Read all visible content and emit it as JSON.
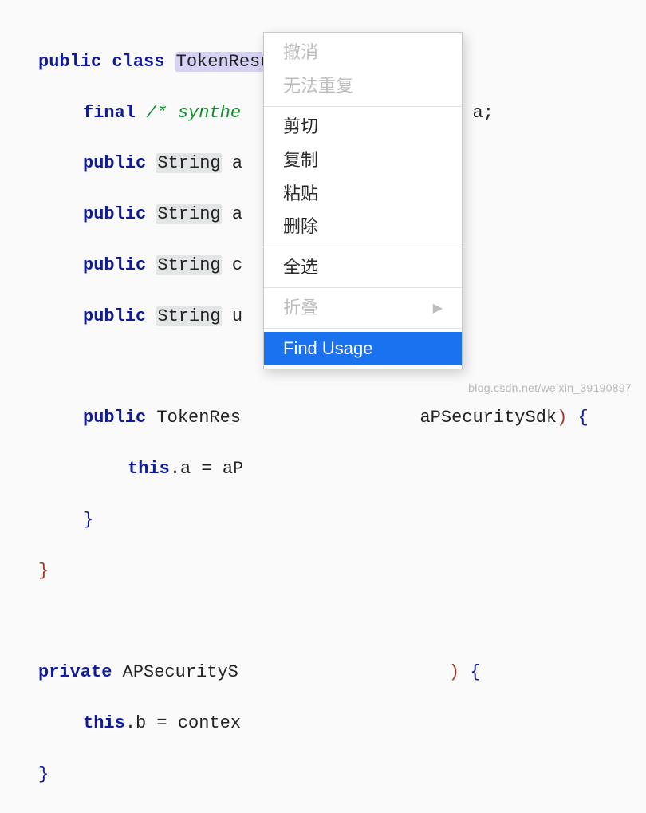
{
  "code": {
    "l1_kw_public": "public",
    "l1_kw_class": "class",
    "l1_classname": "TokenResult",
    "l1_brace": "{",
    "l2_kw_final": "final",
    "l2_comment": "/* synthe",
    "l2_tail": "Sdk a;",
    "l3_kw": "public",
    "l3_type": "String",
    "l3_tail": "a",
    "l4_kw": "public",
    "l4_type": "String",
    "l4_tail": "a",
    "l5_kw": "public",
    "l5_type": "String",
    "l5_tail": "c",
    "l6_kw": "public",
    "l6_type": "String",
    "l6_tail": "u",
    "l8_kw": "public",
    "l8_name": "TokenRes",
    "l8_tail_pre": "aPSecuritySdk",
    "l8_tail_paren": ")",
    "l8_brace": "{",
    "l9_kw_this": "this",
    "l9_rest": ".a = aP",
    "l10_brace": "}",
    "l11_brace": "}",
    "l13_kw_private": "private",
    "l13_name": "APSecurityS",
    "l13_paren": ")",
    "l13_brace": "{",
    "l14_kw_this": "this",
    "l14_rest": ".b = contex",
    "l15_brace": "}"
  },
  "menu": {
    "undo": "撤消",
    "redo": "无法重复",
    "cut": "剪切",
    "copy": "复制",
    "paste": "粘贴",
    "delete": "删除",
    "selectAll": "全选",
    "fold": "折叠",
    "arrow": "▶",
    "findUsage": "Find Usage"
  },
  "watermark": "blog.csdn.net/weixin_39190897"
}
